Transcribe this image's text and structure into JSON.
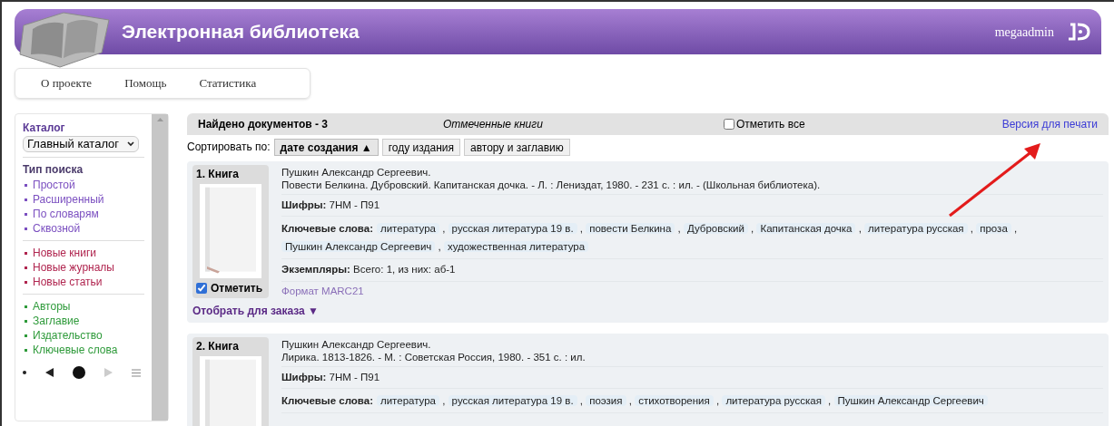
{
  "header": {
    "title": "Электронная библиотека",
    "user": "megaadmin"
  },
  "nav": [
    {
      "label": "О проекте"
    },
    {
      "label": "Помощь"
    },
    {
      "label": "Статистика"
    }
  ],
  "sidebar": {
    "catalog_label": "Каталог",
    "catalog_select": "Главный каталог",
    "search_type_label": "Тип поиска",
    "groups": [
      {
        "color": "#7b4fc0",
        "items": [
          "Простой",
          "Расширенный",
          "По словарям",
          "Сквозной"
        ]
      },
      {
        "color": "#b0254f",
        "items": [
          "Новые книги",
          "Новые журналы",
          "Новые статьи"
        ]
      },
      {
        "color": "#2e9a3a",
        "items": [
          "Авторы",
          "Заглавие",
          "Издательство",
          "Ключевые слова"
        ]
      }
    ]
  },
  "results": {
    "found": "Найдено документов - 3",
    "marked_books": "Отмеченные книги",
    "mark_all": {
      "label": "Отметить все",
      "checked": false
    },
    "print_link": "Версия для печати",
    "sort_label": "Сортировать по:",
    "sort_options": [
      {
        "label": "дате создания ▲",
        "selected": true
      },
      {
        "label": "году издания",
        "selected": false
      },
      {
        "label": "автору и заглавию",
        "selected": false
      }
    ],
    "records": [
      {
        "label": "1. Книга",
        "mark": {
          "label": "Отметить",
          "checked": true
        },
        "author": "Пушкин Александр Сергеевич.",
        "description": "Повести Белкина. Дубровский. Капитанская дочка. - Л. : Лениздат, 1980. - 231 с. : ил. - (Школьная библиотека).",
        "fields": [
          {
            "kind": "plain",
            "label": "Шифры:",
            "value": "7НМ - П91"
          },
          {
            "kind": "keywords",
            "label": "Ключевые слова:",
            "separator": ",",
            "values": [
              "литература",
              "русская литература 19 в.",
              "повести Белкина",
              "Дубровский",
              "Капитанская дочка",
              "литература русская",
              "проза",
              "Пушкин Александр Сергеевич",
              "художественная литература"
            ]
          },
          {
            "kind": "plain",
            "label": "Экземпляры:",
            "value": "Всего: 1, из них: аб-1"
          },
          {
            "kind": "link",
            "value": "Формат MARC21"
          }
        ],
        "order": "Отобрать для заказа ▼"
      },
      {
        "label": "2. Книга",
        "author": "Пушкин Александр Сергеевич.",
        "description": "Лирика. 1813-1826. - М. : Советская Россия, 1980. - 351 с. : ил.",
        "fields": [
          {
            "kind": "plain",
            "label": "Шифры:",
            "value": "7НМ - П91"
          },
          {
            "kind": "keywords",
            "label": "Ключевые слова:",
            "separator": ",",
            "values": [
              "литература",
              "русская литература 19 в.",
              "поэзия",
              "стихотворения",
              "литература русская",
              "Пушкин Александр Сергеевич"
            ]
          }
        ]
      }
    ]
  }
}
